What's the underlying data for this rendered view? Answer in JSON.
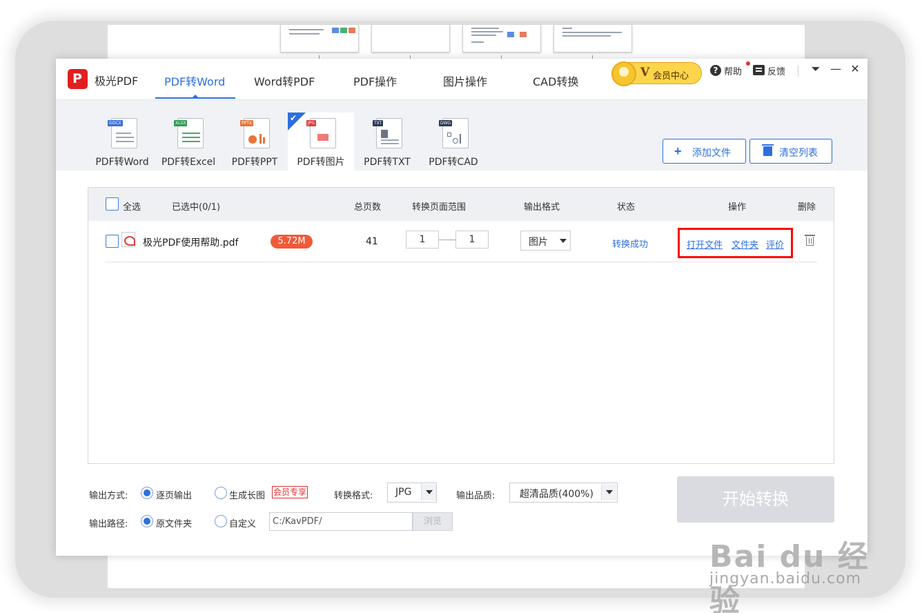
{
  "app": {
    "brand": "极光PDF",
    "logo_letter": "P"
  },
  "nav": {
    "tabs": [
      {
        "label": "PDF转Word",
        "active": true
      },
      {
        "label": "Word转PDF"
      },
      {
        "label": "PDF操作"
      },
      {
        "label": "图片操作"
      },
      {
        "label": "CAD转换"
      }
    ]
  },
  "header": {
    "vip_label": "会员中心",
    "vip_badge": "V",
    "help_label": "帮助",
    "help_glyph": "?",
    "feedback_label": "反馈",
    "menu_glyph": "⏷",
    "minimize_glyph": "—",
    "close_glyph": "✕"
  },
  "tools": [
    {
      "label": "PDF转Word",
      "tag": "DOCX",
      "tag_color": "#3a6fd8"
    },
    {
      "label": "PDF转Excel",
      "tag": "XLSX",
      "tag_color": "#2e9a4e"
    },
    {
      "label": "PDF转PPT",
      "tag": "PPTX",
      "tag_color": "#e8743b"
    },
    {
      "label": "PDF转图片",
      "tag": "JPG",
      "tag_color": "#e03a3a",
      "active": true
    },
    {
      "label": "PDF转TXT",
      "tag": "TXT",
      "tag_color": "#2b3a55"
    },
    {
      "label": "PDF转CAD",
      "tag": "DWG",
      "tag_color": "#2b3a55"
    }
  ],
  "actions": {
    "add_file": "添加文件",
    "add_icon": "+",
    "clear_list": "清空列表"
  },
  "table": {
    "headers": {
      "select_all": "全选",
      "selected": "已选中(0/1)",
      "total_pages": "总页数",
      "page_range": "转换页面范围",
      "output_format": "输出格式",
      "status": "状态",
      "operations": "操作",
      "delete": "删除"
    },
    "rows": [
      {
        "filename": "极光PDF使用帮助.pdf",
        "size": "5.72M",
        "pages": "41",
        "range_from": "1",
        "range_to": "1",
        "format": "图片",
        "status": "转换成功",
        "op_open": "打开文件",
        "op_folder": "文件夹",
        "op_rate": "评价"
      }
    ]
  },
  "options": {
    "output_mode_label": "输出方式:",
    "mode_per_page": "逐页输出",
    "mode_long_image": "生成长图",
    "vip_only": "会员专享",
    "convert_format_label": "转换格式:",
    "convert_format_value": "JPG",
    "quality_label": "输出品质:",
    "quality_value": "超清品质(400%)",
    "output_path_label": "输出路径:",
    "path_original": "原文件夹",
    "path_custom": "自定义",
    "path_value": "C:/KavPDF/",
    "browse": "浏览",
    "start": "开始转换"
  },
  "watermark": {
    "main": "Bai du 经验",
    "sub": "jingyan.baidu.com"
  }
}
